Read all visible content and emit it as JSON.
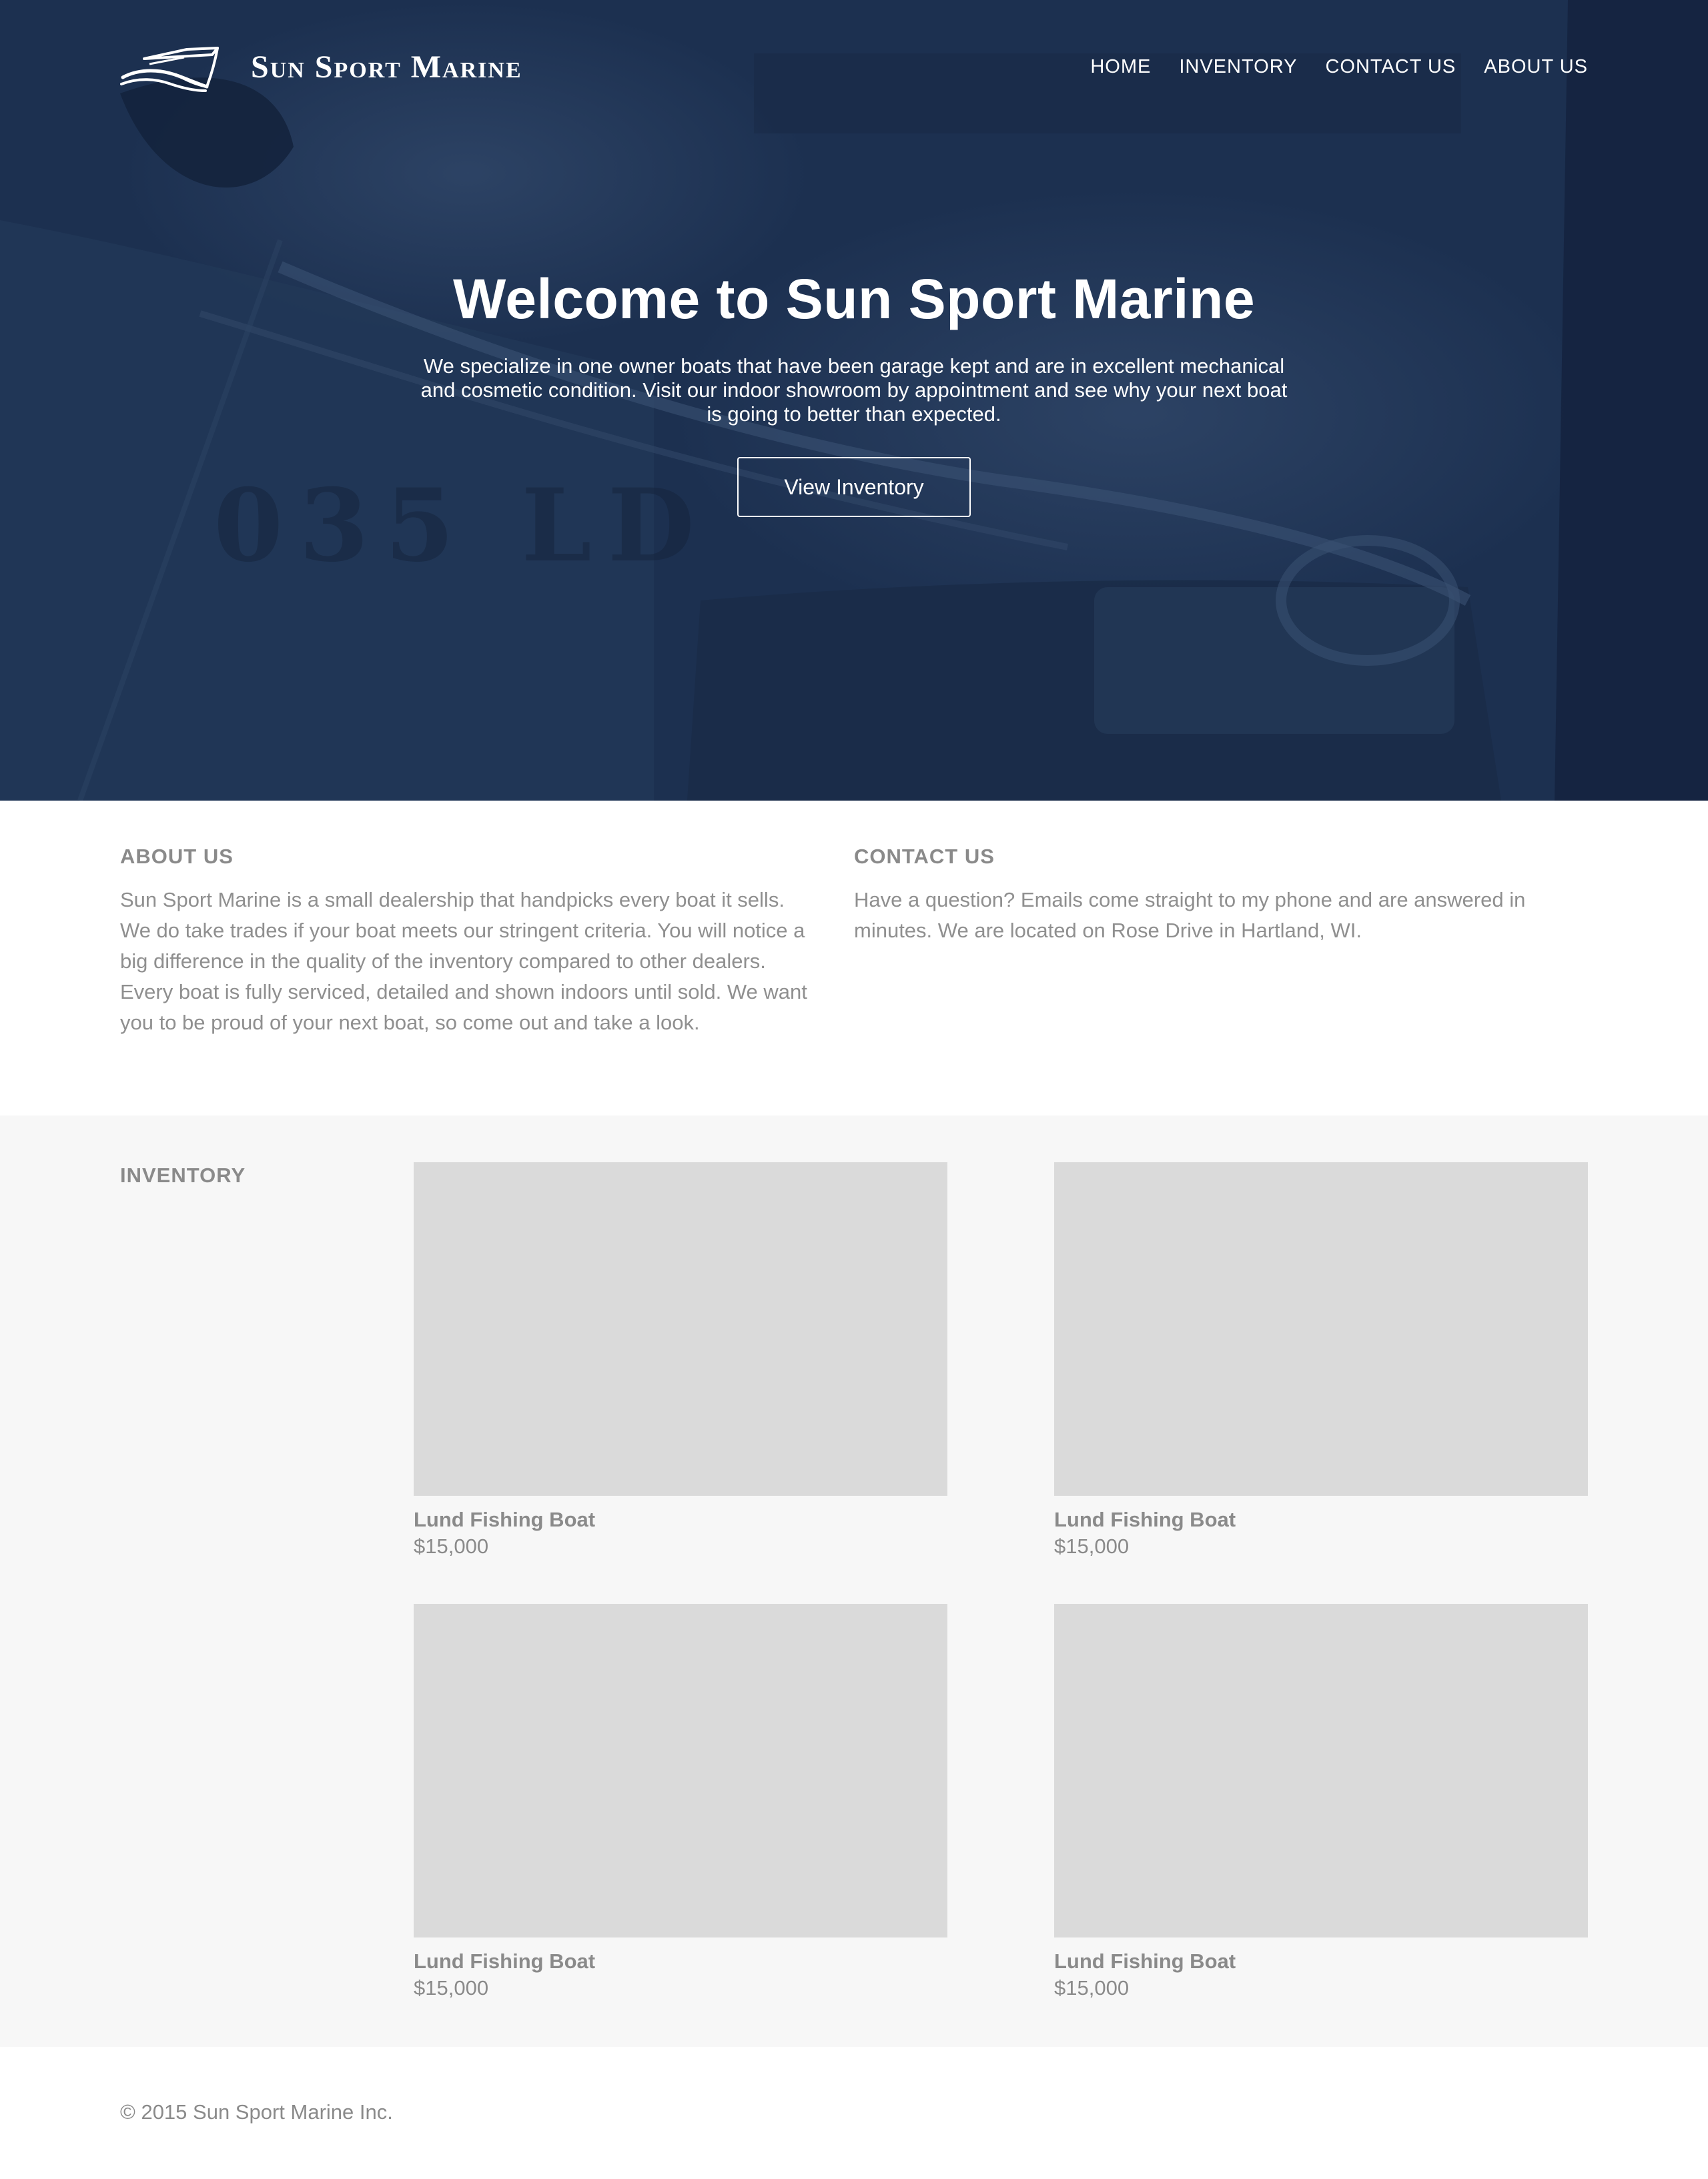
{
  "header": {
    "brand_name": "Sun Sport Marine",
    "logo_icon": "boat-logo-icon",
    "nav": [
      {
        "label": "HOME"
      },
      {
        "label": "INVENTORY"
      },
      {
        "label": "CONTACT US"
      },
      {
        "label": "ABOUT US"
      }
    ]
  },
  "hero": {
    "title": "Welcome to Sun Sport Marine",
    "subtitle": "We specialize in one owner boats that have been garage kept and are in excellent mechanical and cosmetic condition. Visit our indoor showroom by appointment and see why your next boat is going to better than expected.",
    "button_label": "View Inventory",
    "boat_registration": "035 LD"
  },
  "about": {
    "title": "ABOUT US",
    "text": "Sun Sport Marine is a small dealership that handpicks every boat it sells. We do take trades if your boat meets our stringent criteria. You will notice a big difference in the quality of the inventory compared to other dealers. Every boat is fully serviced, detailed and shown indoors until sold. We want you to be proud of your next boat, so come out and take a look."
  },
  "contact": {
    "title": "CONTACT US",
    "text": "Have a question? Emails come straight to my phone and are answered in minutes. We are located on Rose Drive in Hartland, WI."
  },
  "inventory": {
    "title": "INVENTORY",
    "items": [
      {
        "name": "Lund Fishing Boat",
        "price": "$15,000"
      },
      {
        "name": "Lund Fishing Boat",
        "price": "$15,000"
      },
      {
        "name": "Lund Fishing Boat",
        "price": "$15,000"
      },
      {
        "name": "Lund Fishing Boat",
        "price": "$15,000"
      }
    ]
  },
  "footer": {
    "copyright": "© 2015 Sun Sport Marine Inc."
  },
  "colors": {
    "hero_overlay": "#1c3050",
    "inventory_bg": "#f7f7f7",
    "placeholder": "#dadada",
    "text_gray": "#8a8a8a"
  }
}
